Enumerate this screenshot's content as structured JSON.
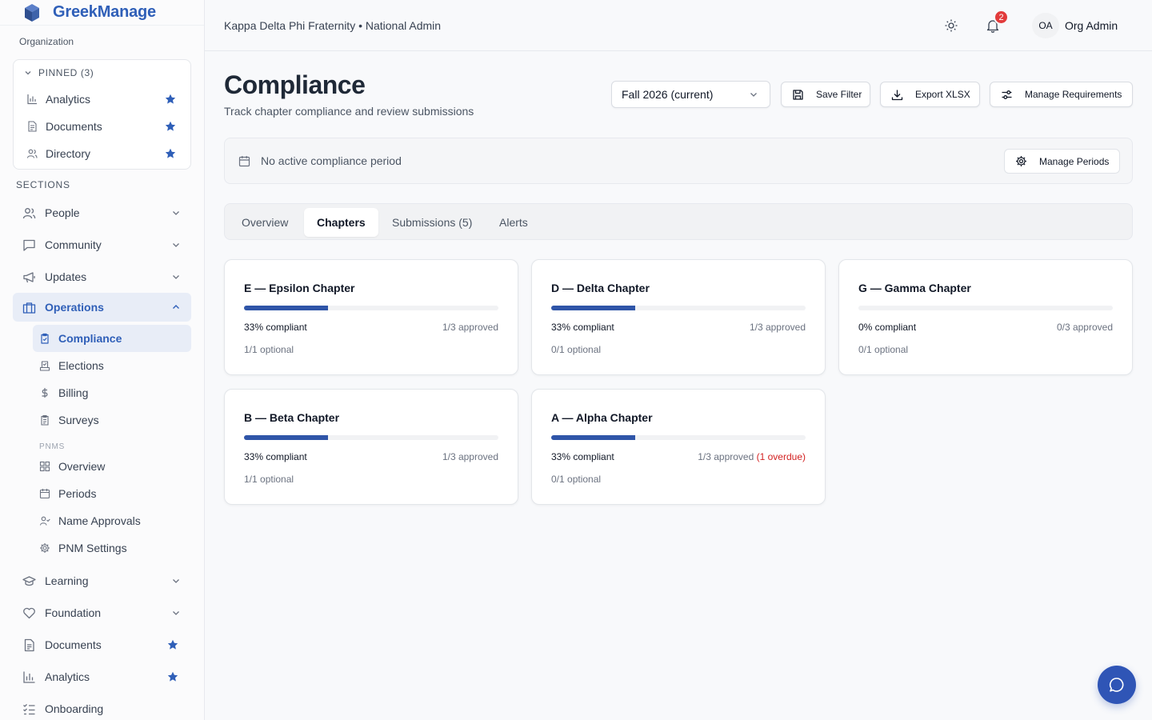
{
  "brand": {
    "name": "GreekManage"
  },
  "sidebar": {
    "org_label": "Organization",
    "pinned_label": "PINNED (3)",
    "pinned": [
      {
        "label": "Analytics",
        "icon": "bar-chart-icon"
      },
      {
        "label": "Documents",
        "icon": "document-icon"
      },
      {
        "label": "Directory",
        "icon": "users-icon"
      }
    ],
    "sections_label": "SECTIONS",
    "sections": {
      "people": "People",
      "community": "Community",
      "updates": "Updates",
      "operations": "Operations",
      "learning": "Learning",
      "foundation": "Foundation",
      "documents": "Documents",
      "analytics": "Analytics",
      "onboarding": "Onboarding"
    },
    "operations_items": {
      "compliance": "Compliance",
      "elections": "Elections",
      "billing": "Billing",
      "surveys": "Surveys"
    },
    "pnms_label": "PNMS",
    "pnms_items": {
      "overview": "Overview",
      "periods": "Periods",
      "name_approvals": "Name Approvals",
      "pnm_settings": "PNM Settings"
    }
  },
  "header": {
    "breadcrumb": "Kappa Delta Phi Fraternity • National Admin",
    "notification_count": "2",
    "avatar_initials": "OA",
    "user_name": "Org Admin"
  },
  "page": {
    "title": "Compliance",
    "subtitle": "Track chapter compliance and review submissions",
    "period_select": "Fall 2026 (current)",
    "save_filter": "Save Filter",
    "export": "Export XLSX",
    "manage_requirements": "Manage Requirements",
    "period_notice": "No active compliance period",
    "manage_periods": "Manage Periods"
  },
  "tabs": {
    "overview": "Overview",
    "chapters": "Chapters",
    "submissions": "Submissions (5)",
    "alerts": "Alerts"
  },
  "chapters": [
    {
      "title": "E — Epsilon Chapter",
      "progress": 0.33,
      "pct": "33% compliant",
      "approved": "1/3 approved",
      "overdue": "",
      "optional": "1/1 optional"
    },
    {
      "title": "D — Delta Chapter",
      "progress": 0.33,
      "pct": "33% compliant",
      "approved": "1/3 approved",
      "overdue": "",
      "optional": "0/1 optional"
    },
    {
      "title": "G — Gamma Chapter",
      "progress": 0,
      "pct": "0% compliant",
      "approved": "0/3 approved",
      "overdue": "",
      "optional": "0/1 optional"
    },
    {
      "title": "B — Beta Chapter",
      "progress": 0.33,
      "pct": "33% compliant",
      "approved": "1/3 approved",
      "overdue": "",
      "optional": "1/1 optional"
    },
    {
      "title": "A — Alpha Chapter",
      "progress": 0.33,
      "pct": "33% compliant",
      "approved": "1/3 approved",
      "overdue": "(1 overdue)",
      "optional": "0/1 optional"
    }
  ],
  "colors": {
    "brand": "#2f5fb8",
    "progress": "#2f55a8",
    "overdue": "#d32222",
    "badge": "#e23b3b"
  }
}
